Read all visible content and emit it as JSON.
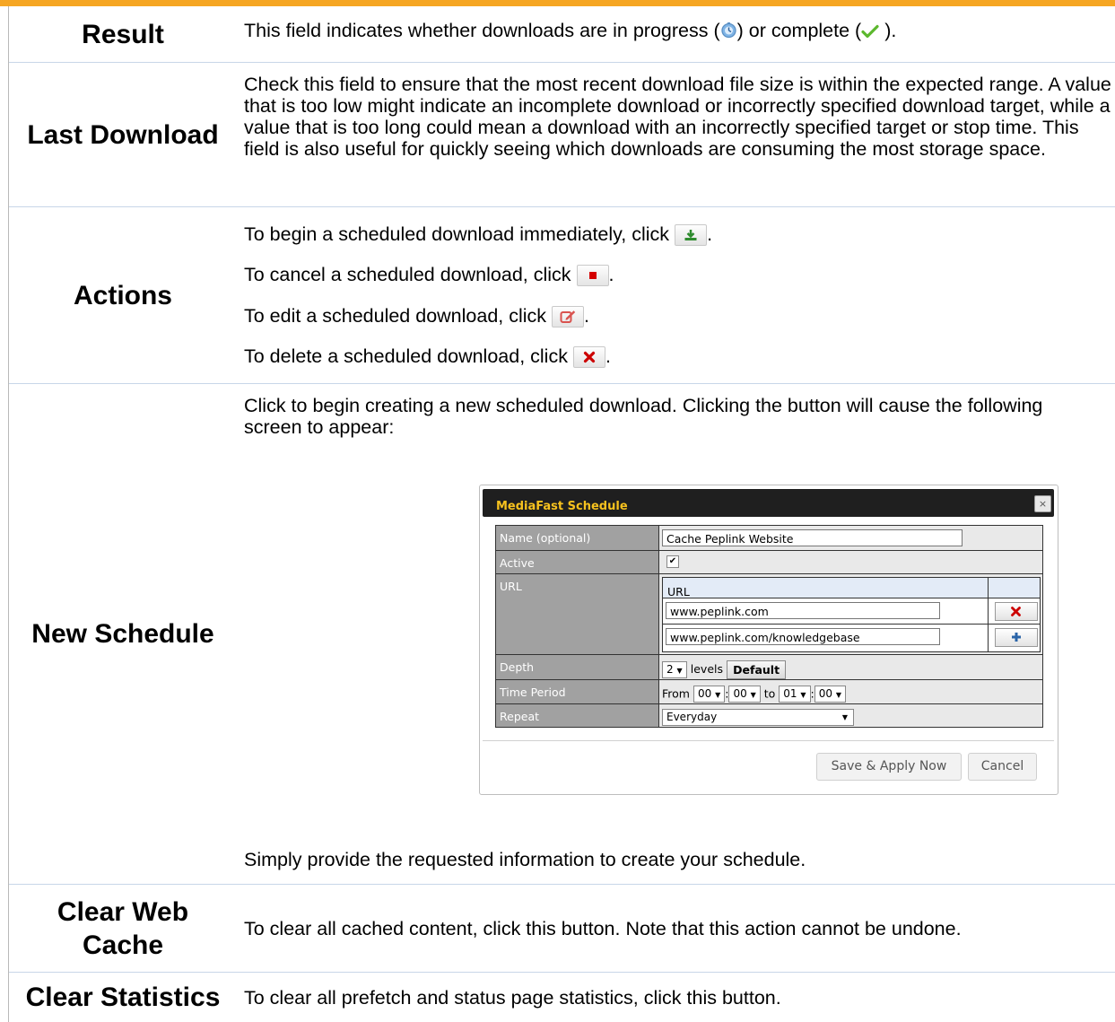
{
  "rows": {
    "result": {
      "label": "Result",
      "text_before": "This field indicates whether downloads are in progress (",
      "text_middle": ") or complete (",
      "text_after": " )."
    },
    "last_download": {
      "label": "Last Download",
      "text": "Check this field to ensure that the most recent download file size is within the expected range. A value that is too low might indicate an incomplete download or incorrectly specified download target, while a value that is too long could mean a download with an incorrectly specified target or stop time. This field is also useful for quickly seeing which downloads are consuming the most storage space."
    },
    "actions": {
      "label": "Actions",
      "begin": "To begin a scheduled download immediately, click",
      "cancel": "To cancel a scheduled download, click",
      "edit": "To edit a scheduled download, click",
      "delete": "To delete a scheduled download, click",
      "period": "."
    },
    "new_schedule": {
      "label": "New Schedule",
      "intro": "Click to begin creating a new scheduled download. Clicking the button will cause the following screen to appear:",
      "outro": "Simply provide the requested information to create your schedule."
    },
    "clear_web_cache": {
      "label": "Clear Web Cache",
      "text": "To clear all cached content, click this button. Note that this action cannot be undone."
    },
    "clear_statistics": {
      "label": "Clear Statistics",
      "text": "To clear all prefetch and status page statistics, click this button."
    }
  },
  "dialog": {
    "title": "MediaFast Schedule",
    "close": "×",
    "name_label": "Name (optional)",
    "name_value": "Cache Peplink Website",
    "active_label": "Active",
    "active_check": "✔",
    "url_label": "URL",
    "url_header": "URL",
    "url_1": "www.peplink.com",
    "url_2": "www.peplink.com/knowledgebase",
    "depth_label": "Depth",
    "depth_value": "2",
    "depth_unit": "levels",
    "default_button": "Default",
    "time_label": "Time Period",
    "time_from": "From",
    "from_hour": "00",
    "from_min": "00",
    "time_to": "to",
    "to_hour": "01",
    "to_min": "00",
    "colon": ":",
    "repeat_label": "Repeat",
    "repeat_value": "Everyday",
    "save_button": "Save & Apply Now",
    "cancel_button": "Cancel",
    "arrow": "▼"
  },
  "colors": {
    "top_bar": "#f6a623",
    "dialog_title": "#f7c21e",
    "delete_icon": "#cc0000",
    "add_icon": "#2a64a8",
    "download_icon": "#2e8b2e"
  },
  "icons": [
    "progress-icon",
    "complete-check-icon",
    "download-icon",
    "stop-icon",
    "edit-icon",
    "delete-icon",
    "add-icon"
  ]
}
